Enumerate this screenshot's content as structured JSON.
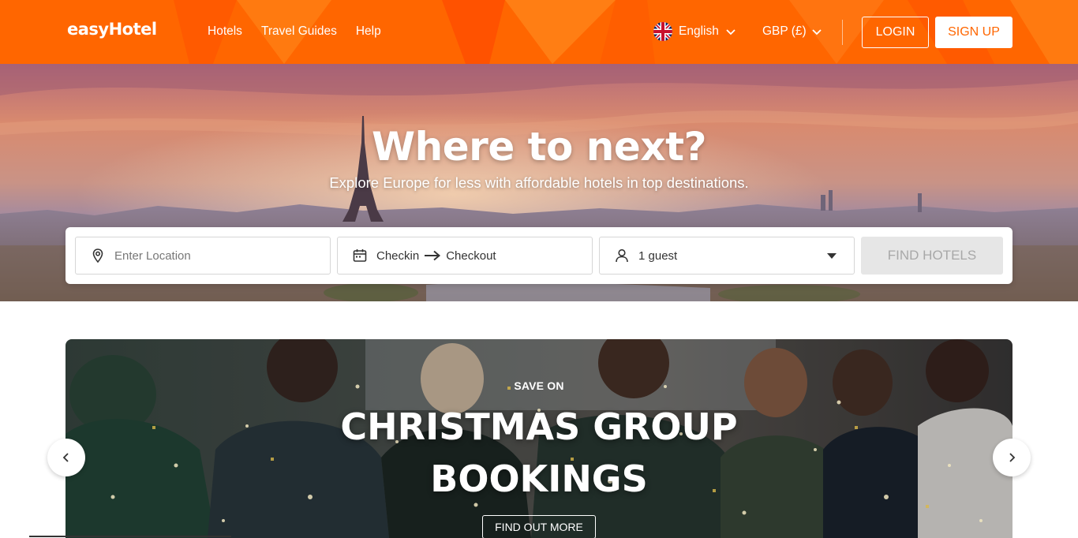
{
  "header": {
    "logo": "easyHotel",
    "nav": [
      {
        "label": "Hotels"
      },
      {
        "label": "Travel Guides"
      },
      {
        "label": "Help"
      }
    ],
    "language": {
      "label": "English",
      "icon": "uk-flag-icon"
    },
    "currency": {
      "label": "GBP (£)"
    },
    "login_label": "LOGIN",
    "signup_label": "SIGN UP",
    "brand_color": "#ff6600"
  },
  "hero": {
    "title": "Where to next?",
    "subtitle": "Explore Europe for less with affordable hotels in top destinations."
  },
  "search": {
    "location_placeholder": "Enter Location",
    "checkin_label": "Checkin",
    "checkout_label": "Checkout",
    "guests_value": "1 guest",
    "find_label": "FIND HOTELS"
  },
  "promo": {
    "pre_title": "SAVE ON",
    "title_line1": "CHRISTMAS GROUP",
    "title_line2": "BOOKINGS",
    "cta_label": "FIND OUT MORE"
  },
  "carousel": {
    "prev_icon": "chevron-left-icon",
    "next_icon": "chevron-right-icon"
  }
}
